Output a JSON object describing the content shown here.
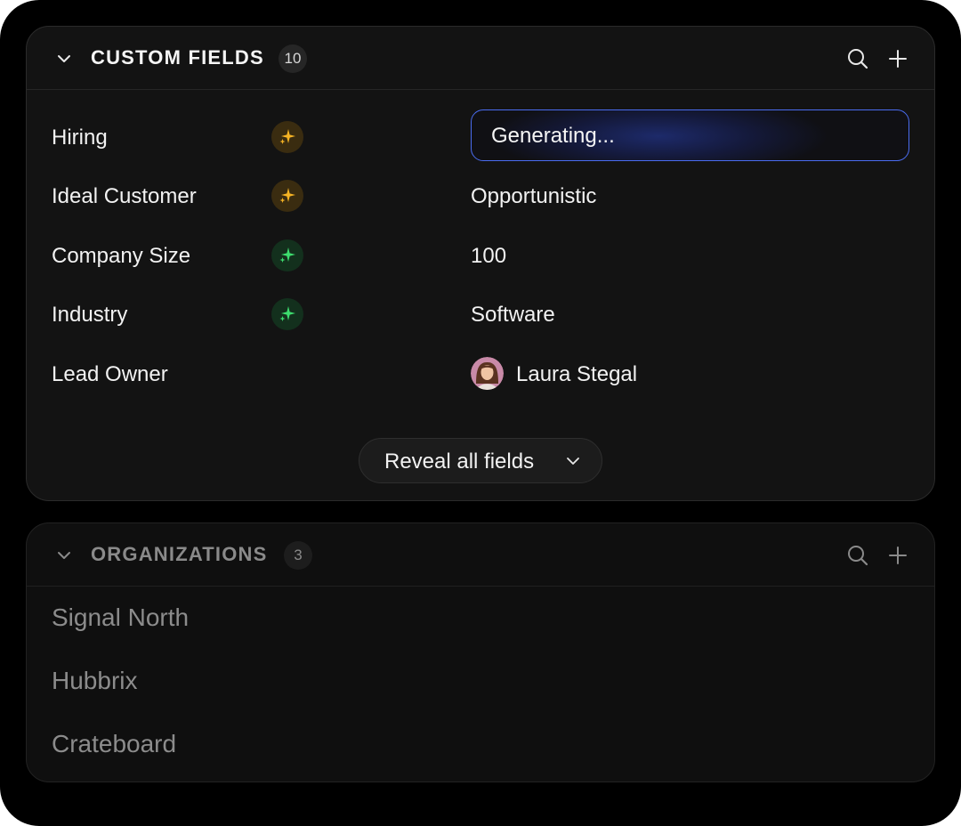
{
  "custom_fields": {
    "title": "CUSTOM FIELDS",
    "count": "10",
    "rows": [
      {
        "label": "Hiring",
        "ai_status": "gold",
        "value": "Generating..."
      },
      {
        "label": "Ideal Customer",
        "ai_status": "gold",
        "value": "Opportunistic"
      },
      {
        "label": "Company Size",
        "ai_status": "green",
        "value": "100"
      },
      {
        "label": "Industry",
        "ai_status": "green",
        "value": "Software"
      },
      {
        "label": "Lead Owner",
        "value": "Laura Stegal"
      }
    ],
    "reveal_label": "Reveal all fields"
  },
  "organizations": {
    "title": "ORGANIZATIONS",
    "count": "3",
    "items": [
      "Signal North",
      "Hubbrix",
      "Crateboard"
    ]
  },
  "icons": {
    "collapse": "chevron-down-icon",
    "search": "search-icon",
    "add": "plus-icon",
    "ai": "sparkle-icon"
  },
  "colors": {
    "ai_gold": "#f5b324",
    "ai_green": "#3ddc6e",
    "generating_border": "#4a6cf0"
  }
}
